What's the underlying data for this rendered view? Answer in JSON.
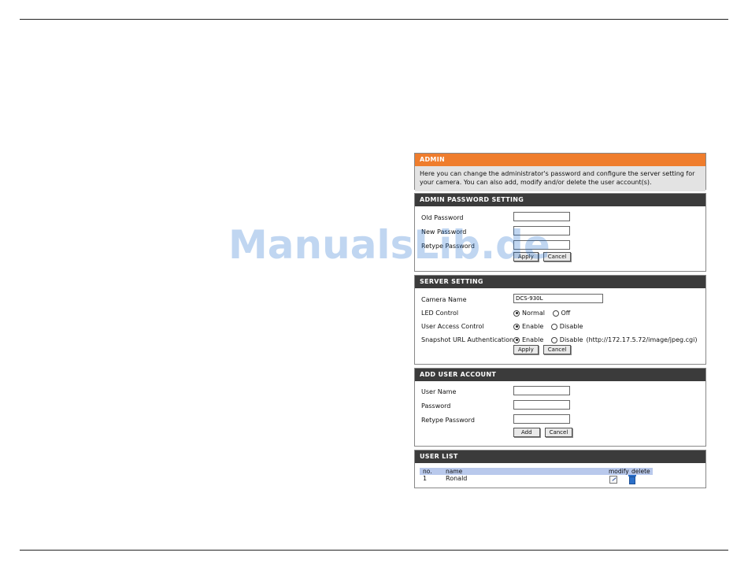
{
  "admin": {
    "title": "ADMIN",
    "description": "Here you can change the administrator's password and configure the server setting for your camera. You can also add, modify and/or delete the user account(s)."
  },
  "admin_password": {
    "title": "ADMIN PASSWORD SETTING",
    "old_label": "Old Password",
    "new_label": "New Password",
    "retype_label": "Retype Password",
    "apply": "Apply",
    "cancel": "Cancel"
  },
  "server": {
    "title": "SERVER SETTING",
    "camera_name_label": "Camera Name",
    "camera_name_value": "DCS-930L",
    "led_label": "LED Control",
    "led_normal": "Normal",
    "led_off": "Off",
    "uac_label": "User Access Control",
    "uac_enable": "Enable",
    "uac_disable": "Disable",
    "snap_label": "Snapshot URL Authentication",
    "snap_enable": "Enable",
    "snap_disable": "Disable",
    "snap_url": "(http://172.17.5.72/image/jpeg.cgi)",
    "apply": "Apply",
    "cancel": "Cancel"
  },
  "add_user": {
    "title": "ADD USER ACCOUNT",
    "user_label": "User Name",
    "password_label": "Password",
    "retype_label": "Retype Password",
    "add": "Add",
    "cancel": "Cancel"
  },
  "user_list": {
    "title": "USER LIST",
    "headers": {
      "no": "no.",
      "name": "name",
      "modify": "modify",
      "delete": "delete"
    },
    "rows": [
      {
        "no": "1",
        "name": "Ronald"
      }
    ]
  },
  "watermark": "ManualsLib.de"
}
